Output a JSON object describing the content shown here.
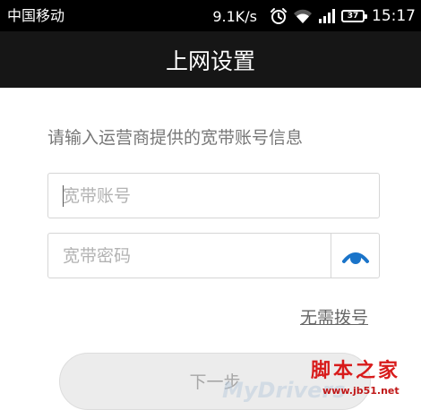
{
  "status_bar": {
    "carrier": "中国移动",
    "network_speed": "9.1K/s",
    "battery_level": "37",
    "time": "15:17",
    "icons": [
      "alarm-icon",
      "wifi-icon",
      "signal-icon",
      "battery-icon"
    ]
  },
  "title_bar": {
    "title": "上网设置"
  },
  "form": {
    "instruction": "请输入运营商提供的宽带账号信息",
    "account_field": {
      "placeholder": "宽带账号",
      "value": ""
    },
    "password_field": {
      "placeholder": "宽带密码",
      "value": "",
      "toggle_icon": "eye-icon"
    },
    "skip_link": "无需拨号",
    "next_button": "下一步"
  },
  "watermark": {
    "site": "脚本之家",
    "domain": "www.jb51.net",
    "brand": "MyDrivers"
  },
  "colors": {
    "status_bar_bg": "#000000",
    "title_bar_bg": "#161616",
    "accent": "#1a74c9",
    "button_bg": "#ececec",
    "watermark_red": "#d81b1b"
  }
}
